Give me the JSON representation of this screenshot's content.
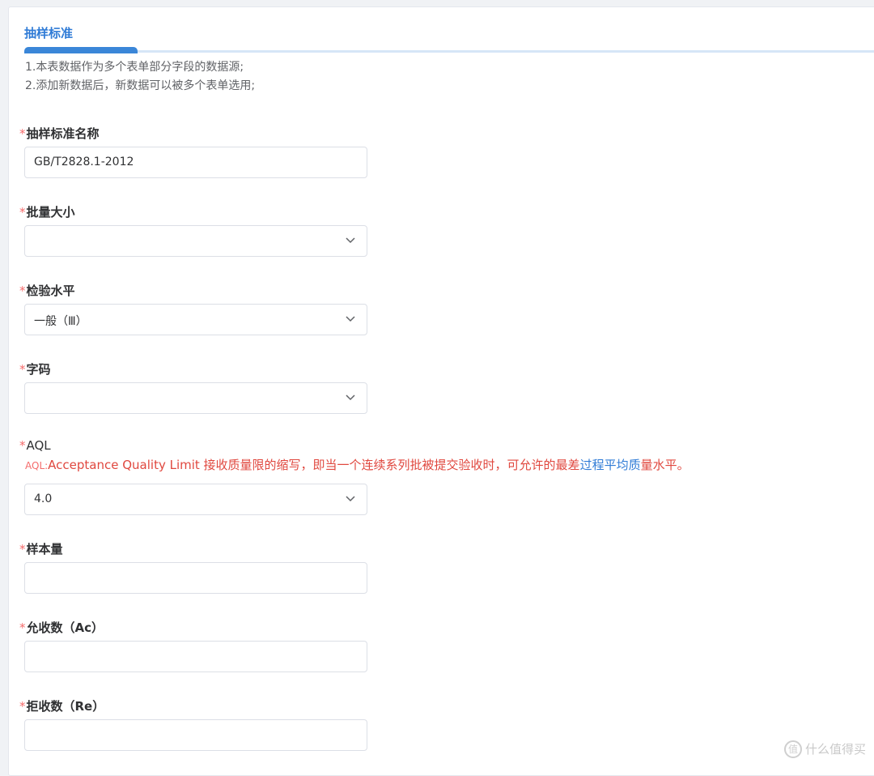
{
  "tab": {
    "title": "抽样标准"
  },
  "notes": [
    "1.本表数据作为多个表单部分字段的数据源;",
    "2.添加新数据后，新数据可以被多个表单选用;"
  ],
  "fields": {
    "standard_name": {
      "required": "*",
      "label": "抽样标准名称",
      "value": "GB/T2828.1-2012"
    },
    "lot_size": {
      "required": "*",
      "label": "批量大小",
      "value": ""
    },
    "inspection_level": {
      "required": "*",
      "label": "检验水平",
      "value": "一般（Ⅲ）"
    },
    "code_letter": {
      "required": "*",
      "label": "字码",
      "value": ""
    },
    "aql": {
      "required": "*",
      "label": "AQL",
      "value": "4.0",
      "description": {
        "prefix": "AQL:",
        "main": "Acceptance Quality Limit 接收质量限的缩写，即当一个连续系列批被提交验收时，可允许的最差",
        "link": "过程平均质",
        "tail": "量水平。"
      }
    },
    "sample_size": {
      "required": "*",
      "label": "样本量",
      "value": ""
    },
    "accept_number": {
      "required": "*",
      "label": "允收数（Ac）",
      "value": ""
    },
    "reject_number": {
      "required": "*",
      "label": "拒收数（Re）",
      "value": ""
    }
  },
  "icons": {
    "dropdown": "chevron-down-icon"
  },
  "colors": {
    "accent": "#2f7bd6",
    "required": "#f56c6c",
    "border": "#dcdfe6"
  },
  "watermark": {
    "logo": "值",
    "text": "什么值得买"
  }
}
